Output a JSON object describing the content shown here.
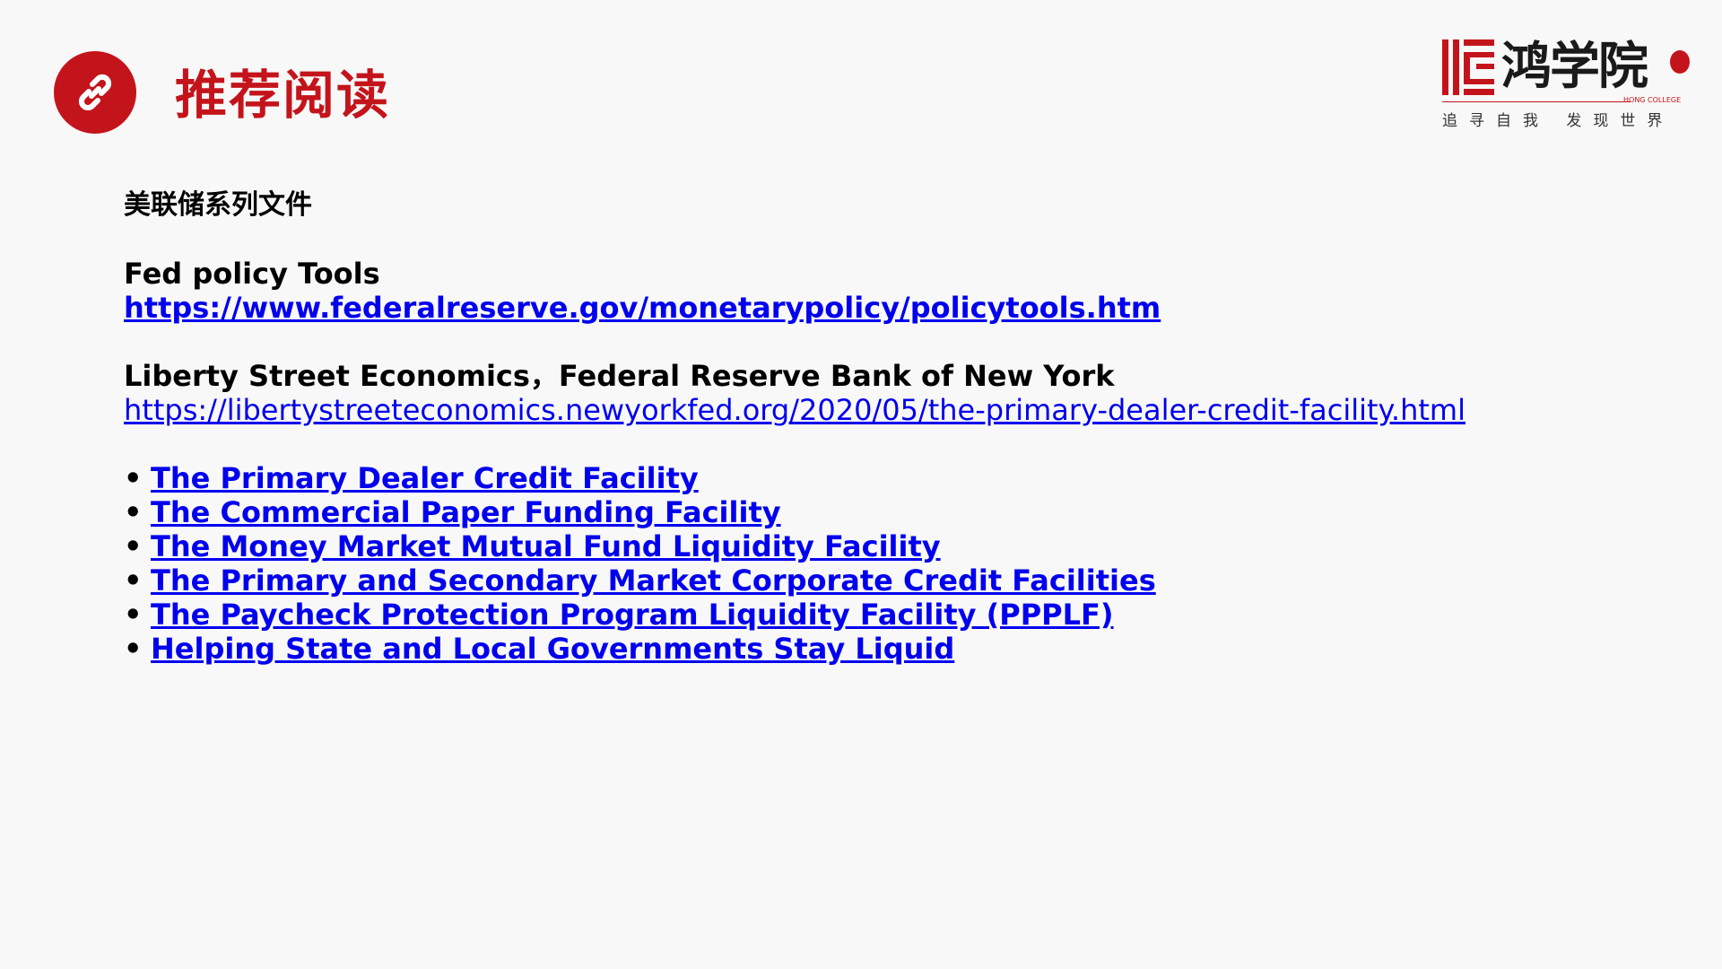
{
  "header": {
    "title": "推荐阅读",
    "icon": "link-icon",
    "accent_color": "#c4141b"
  },
  "logo": {
    "name": "鸿学院",
    "subtitle": "HONG COLLEGE",
    "slogan": "追寻自我  发现世界"
  },
  "content": {
    "section_heading": "美联储系列文件",
    "blocks": [
      {
        "label": "Fed policy Tools",
        "url": "https://www.federalreserve.gov/monetarypolicy/policytools.htm"
      },
      {
        "label": "Liberty Street Economics，Federal Reserve Bank of New York",
        "url": "https://libertystreeteconomics.newyorkfed.org/2020/05/the-primary-dealer-credit-facility.html"
      }
    ],
    "bullet": "•",
    "links": [
      "The Primary Dealer Credit Facility",
      "The Commercial Paper Funding Facility",
      "The Money Market Mutual Fund Liquidity Facility",
      "The Primary and Secondary Market Corporate Credit Facilities",
      "The Paycheck Protection Program Liquidity Facility (PPPLF)",
      "Helping State and Local Governments Stay Liquid"
    ]
  }
}
